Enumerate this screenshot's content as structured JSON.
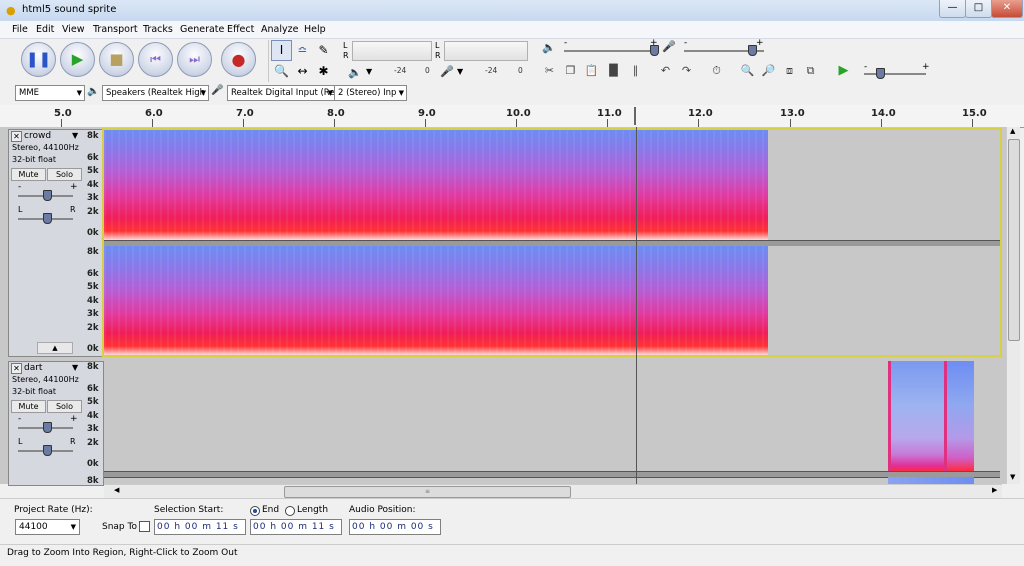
{
  "window": {
    "title": "html5 sound sprite",
    "min_label": "—",
    "max_label": "□",
    "close_label": "✕"
  },
  "menu": [
    "File",
    "Edit",
    "View",
    "Transport",
    "Tracks",
    "Generate",
    "Effect",
    "Analyze",
    "Help"
  ],
  "meters": {
    "play": {
      "ch_l": "L",
      "ch_r": "R"
    },
    "record": {
      "ch_l": "L",
      "ch_r": "R"
    },
    "ticks_top": [
      "-24",
      "0",
      "-24",
      "0"
    ],
    "ticks_bottom": [
      "-24",
      "0",
      "-24",
      "0"
    ]
  },
  "mixer": {
    "plus": "+",
    "minus": "-",
    "speed_minus": "-",
    "speed_plus": "+"
  },
  "devices": {
    "host": "MME",
    "output": "Speakers (Realtek High",
    "input": "Realtek Digital Input (Re",
    "channels": "2 (Stereo) Inp"
  },
  "ruler": {
    "labels": [
      "5.0",
      "6.0",
      "7.0",
      "8.0",
      "9.0",
      "10.0",
      "11.0",
      "12.0",
      "13.0",
      "14.0",
      "15.0"
    ]
  },
  "tracks": [
    {
      "name": "crowd",
      "format": "Stereo, 44100Hz",
      "bits": "32-bit float",
      "mute": "Mute",
      "solo": "Solo",
      "gain_minus": "-",
      "gain_plus": "+",
      "pan_l": "L",
      "pan_r": "R",
      "scale": [
        "8k",
        "6k",
        "5k",
        "4k",
        "3k",
        "2k",
        "0k"
      ]
    },
    {
      "name": "dart",
      "format": "Stereo, 44100Hz",
      "bits": "32-bit float",
      "mute": "Mute",
      "solo": "Solo",
      "gain_minus": "-",
      "gain_plus": "+",
      "pan_l": "L",
      "pan_r": "R",
      "scale": [
        "8k",
        "6k",
        "5k",
        "4k",
        "3k",
        "2k",
        "0k"
      ],
      "scale_partial": "8k"
    }
  ],
  "selection": {
    "project_rate_label": "Project Rate (Hz):",
    "project_rate": "44100",
    "snap_label": "Snap To",
    "start_label": "Selection Start:",
    "end_label": "End",
    "length_label": "Length",
    "position_label": "Audio Position:",
    "start": "00 h 00 m 11 s",
    "end": "00 h 00 m 11 s",
    "position": "00 h 00 m 00 s"
  },
  "status": "Drag to Zoom Into Region, Right-Click to Zoom Out",
  "colors": {
    "accent": "#3e64c8",
    "play_green": "#29a329",
    "record_red": "#c62828"
  }
}
